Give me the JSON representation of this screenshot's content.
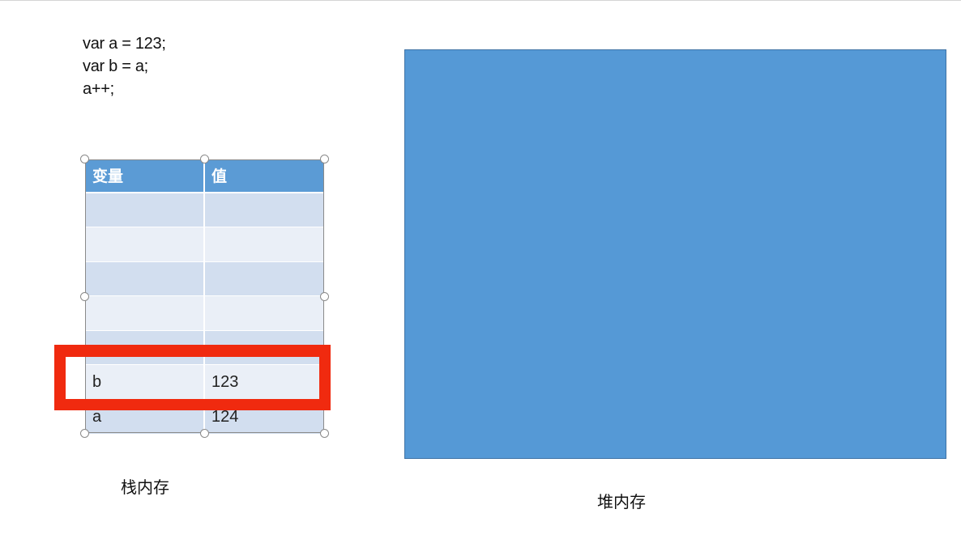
{
  "code": {
    "lines": [
      "var a = 123;",
      "var b = a;",
      "a++;"
    ]
  },
  "stack": {
    "caption": "栈内存",
    "headers": [
      "变量",
      "值"
    ],
    "rows": [
      [
        "",
        ""
      ],
      [
        "",
        ""
      ],
      [
        "",
        ""
      ],
      [
        "",
        ""
      ],
      [
        "",
        ""
      ],
      [
        "b",
        "123"
      ],
      [
        "a",
        "124"
      ]
    ],
    "highlighted_row_index": 5
  },
  "heap": {
    "caption": "堆内存"
  },
  "colors": {
    "header_blue": "#5b9bd5",
    "row_dark": "#d2deef",
    "row_light": "#eaeff7",
    "heap_fill": "#5599d6",
    "highlight_red": "#f02a0f"
  }
}
